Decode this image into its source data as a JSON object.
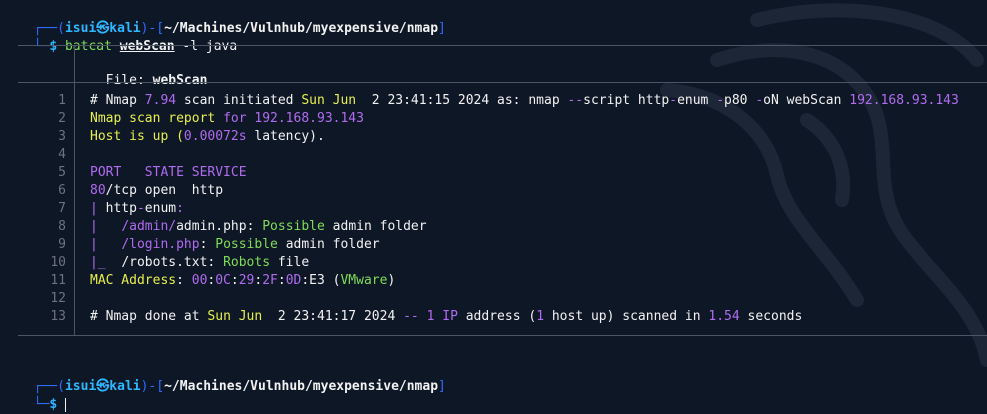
{
  "prompt1": {
    "user": "isui",
    "symbol": "㉿",
    "host": "kali",
    "path": "~/Machines/Vulnhub/myexpensive/nmap",
    "command_bin": "batcat",
    "command_file": "webScan",
    "command_args": "-l java"
  },
  "file_header": {
    "label": "File: ",
    "filename": "webScan"
  },
  "lines": [
    "1",
    "2",
    "3",
    "4",
    "5",
    "6",
    "7",
    "8",
    "9",
    "10",
    "11",
    "12",
    "13"
  ],
  "code": {
    "l1": {
      "a": "# Nmap ",
      "b": "7.94",
      "c": " scan initiated ",
      "d": "Sun Jun",
      "e": "  2 23:41:15 2024",
      "f": " as: nmap ",
      "g": "--",
      "h": "script http",
      "i": "-",
      "j": "enum ",
      "k": "-",
      "l": "p80 ",
      "m": "-",
      "n": "oN webScan ",
      "o": "192.168.93.143"
    },
    "l2": {
      "a": "Nmap scan report ",
      "b": "for",
      "c": " 192.168.93.143"
    },
    "l3": {
      "a": "Host is up (",
      "b": "0.00072s",
      "c": " latency)."
    },
    "l5": {
      "a": "PORT   STATE SERVICE"
    },
    "l6": {
      "a": "80",
      "b": "/tcp open  http"
    },
    "l7": {
      "a": "| ",
      "b": "http",
      "c": "-",
      "d": "enum",
      "e": ":"
    },
    "l8": {
      "a": "|   ",
      "b": "/admin/",
      "c": "admin.php",
      "d": ": ",
      "e": "Possible",
      "f": " admin folder"
    },
    "l9": {
      "a": "|   ",
      "b": "/login.php",
      "c": ": ",
      "d": "Possible",
      "e": " admin folder"
    },
    "l10": {
      "a": "|_  ",
      "b": "/robots.txt",
      "c": ": ",
      "d": "Robots",
      "e": " file"
    },
    "l11": {
      "a": "MAC Address",
      "b": ": ",
      "c": "00",
      "d": ":",
      "e": "0C",
      "f": ":",
      "g": "29",
      "h": ":",
      "i": "2F",
      "j": ":",
      "k": "0D",
      "l": ":",
      "m": "E3",
      "n": " (",
      "o": "VMware",
      "p": ")"
    },
    "l13": {
      "a": "# Nmap ",
      "b": "done at ",
      "c": "Sun Jun",
      "d": "  2 23:41:17 2024",
      "e": " -- ",
      "f": "1",
      "g": " IP",
      "h": " address (",
      "i": "1",
      "j": " host up) scanned in ",
      "k": "1.54",
      "l": " seconds"
    }
  },
  "prompt2": {
    "user": "isui",
    "symbol": "㉿",
    "host": "kali",
    "path": "~/Machines/Vulnhub/myexpensive/nmap",
    "dollar": "$"
  },
  "colors": {
    "background": "#0e1726",
    "prompt_blue": "#2f6bff",
    "prompt_cyan": "#2fb7ff",
    "purple": "#b06cf0",
    "green": "#7fdc58",
    "yellow": "#e7ef4d"
  },
  "icons": {
    "watermark": "kali-dragon-icon"
  }
}
